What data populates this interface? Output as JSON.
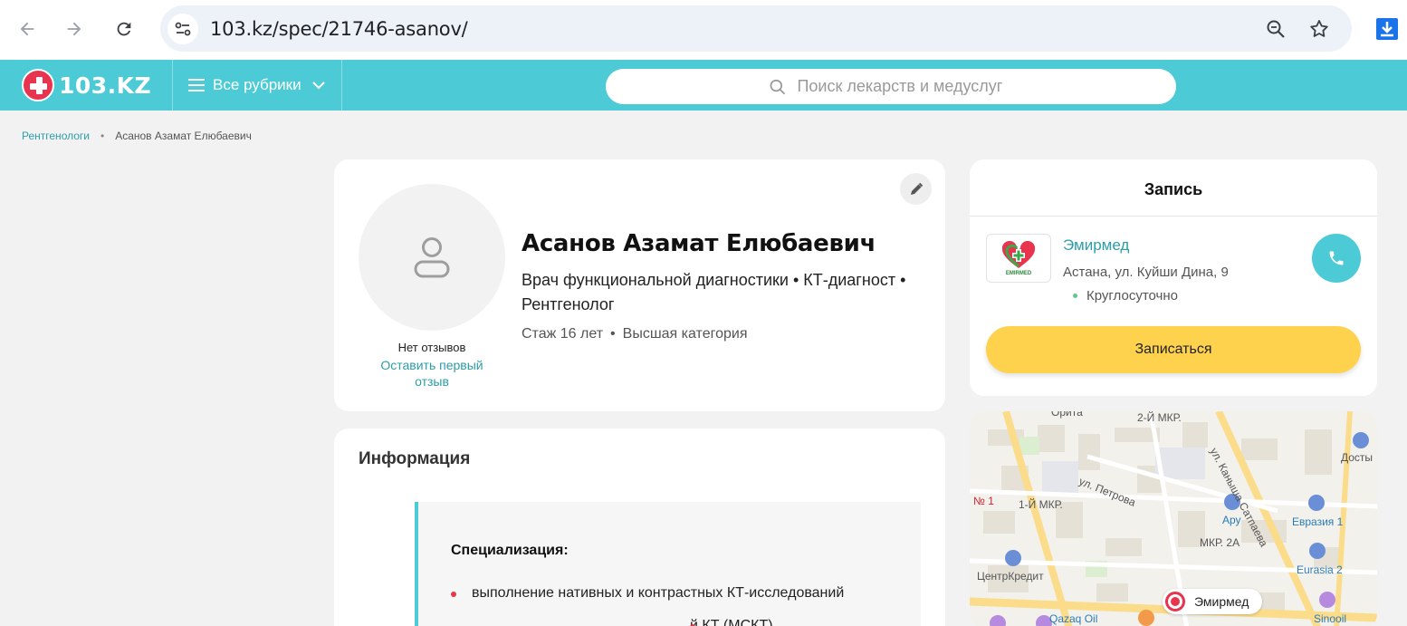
{
  "browser": {
    "url": "103.kz/spec/21746-asanov/"
  },
  "header": {
    "logo_text": "103.KZ",
    "rubrics_label": "Все рубрики",
    "search_placeholder": "Поиск лекарств и медуслуг"
  },
  "breadcrumb": {
    "parent": "Рентгенологи",
    "current": "Асанов Азамат Елюбаевич"
  },
  "profile": {
    "name": "Асанов Азамат Елюбаевич",
    "specialties": "Врач функциональной диагностики • КТ-диагност • Рентгенолог",
    "experience": "Стаж 16 лет",
    "category": "Высшая категория",
    "no_reviews": "Нет отзывов",
    "leave_review": "Оставить первый отзыв"
  },
  "info": {
    "title": "Информация",
    "spec_heading": "Специализация:",
    "bullets": [
      "выполнение нативных и контрастных КТ-исследований",
      "й КТ (МСКТ)"
    ]
  },
  "booking": {
    "title": "Запись",
    "clinic_name": "Эмирмед",
    "clinic_logo_text": "EMIRMED",
    "address": "Астана, ул. Куйши Дина, 9",
    "hours": "Круглосуточно",
    "book_label": "Записаться"
  },
  "map": {
    "labels": [
      "Орита",
      "2-Й МКР.",
      "ул. Каныша Сатпаева",
      "Досты",
      "ул. Петрова",
      "№ 1",
      "1-Й МКР.",
      "Ару",
      "Евразия 1",
      "МКР. 2А",
      "ЦентрКредит",
      "Eurasia 2",
      "Qazaq Oil",
      "Sinooil"
    ],
    "pin_label": "Эмирмед"
  },
  "colors": {
    "brand": "#4ccbd6",
    "accent_red": "#e8344e",
    "button_yellow": "#ffd24d",
    "link": "#2c9ea8"
  }
}
